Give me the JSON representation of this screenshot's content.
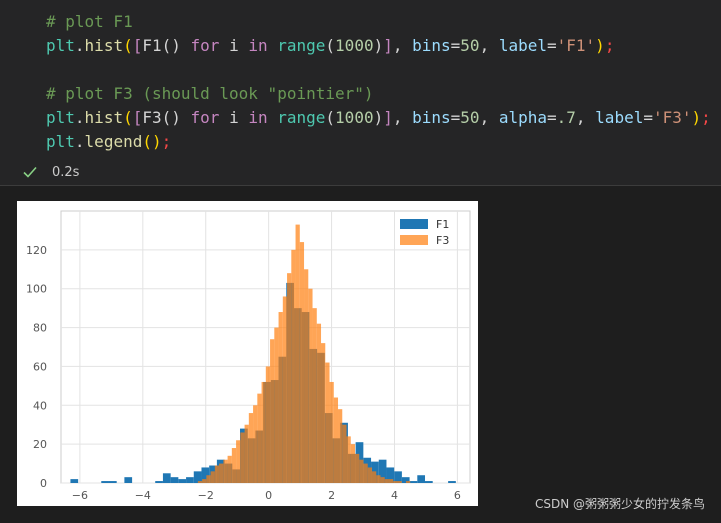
{
  "cell": {
    "code_lines": [
      [
        {
          "t": "# plot F1",
          "c": "t-comment"
        }
      ],
      [
        {
          "t": "plt",
          "c": "t-fn"
        },
        {
          "t": ".",
          "c": "t-punct"
        },
        {
          "t": "hist",
          "c": "t-builtin"
        },
        {
          "t": "(",
          "c": "t-yellow"
        },
        {
          "t": "[",
          "c": "t-kw"
        },
        {
          "t": "F1",
          "c": "t-punct"
        },
        {
          "t": "()",
          "c": "t-punct"
        },
        {
          "t": " for ",
          "c": "t-kw"
        },
        {
          "t": "i",
          "c": "t-punct"
        },
        {
          "t": " in ",
          "c": "t-kw"
        },
        {
          "t": "range",
          "c": "t-fn"
        },
        {
          "t": "(",
          "c": "t-punct"
        },
        {
          "t": "1000",
          "c": "t-num"
        },
        {
          "t": ")",
          "c": "t-punct"
        },
        {
          "t": "]",
          "c": "t-kw"
        },
        {
          "t": ", ",
          "c": "t-punct"
        },
        {
          "t": "bins",
          "c": "t-param"
        },
        {
          "t": "=",
          "c": "t-punct"
        },
        {
          "t": "50",
          "c": "t-num"
        },
        {
          "t": ", ",
          "c": "t-punct"
        },
        {
          "t": "label",
          "c": "t-param"
        },
        {
          "t": "=",
          "c": "t-punct"
        },
        {
          "t": "'F1'",
          "c": "t-str"
        },
        {
          "t": ")",
          "c": "t-yellow"
        },
        {
          "t": ";",
          "c": "t-red"
        }
      ],
      [],
      [
        {
          "t": "# plot F3 (should look \"pointier\")",
          "c": "t-comment"
        }
      ],
      [
        {
          "t": "plt",
          "c": "t-fn"
        },
        {
          "t": ".",
          "c": "t-punct"
        },
        {
          "t": "hist",
          "c": "t-builtin"
        },
        {
          "t": "(",
          "c": "t-yellow"
        },
        {
          "t": "[",
          "c": "t-kw"
        },
        {
          "t": "F3",
          "c": "t-punct"
        },
        {
          "t": "()",
          "c": "t-punct"
        },
        {
          "t": " for ",
          "c": "t-kw"
        },
        {
          "t": "i",
          "c": "t-punct"
        },
        {
          "t": " in ",
          "c": "t-kw"
        },
        {
          "t": "range",
          "c": "t-fn"
        },
        {
          "t": "(",
          "c": "t-punct"
        },
        {
          "t": "1000",
          "c": "t-num"
        },
        {
          "t": ")",
          "c": "t-punct"
        },
        {
          "t": "]",
          "c": "t-kw"
        },
        {
          "t": ", ",
          "c": "t-punct"
        },
        {
          "t": "bins",
          "c": "t-param"
        },
        {
          "t": "=",
          "c": "t-punct"
        },
        {
          "t": "50",
          "c": "t-num"
        },
        {
          "t": ", ",
          "c": "t-punct"
        },
        {
          "t": "alpha",
          "c": "t-param"
        },
        {
          "t": "=",
          "c": "t-punct"
        },
        {
          "t": ".7",
          "c": "t-num"
        },
        {
          "t": ", ",
          "c": "t-punct"
        },
        {
          "t": "label",
          "c": "t-param"
        },
        {
          "t": "=",
          "c": "t-punct"
        },
        {
          "t": "'F3'",
          "c": "t-str"
        },
        {
          "t": ")",
          "c": "t-yellow"
        },
        {
          "t": ";",
          "c": "t-red"
        }
      ],
      [
        {
          "t": "plt",
          "c": "t-fn"
        },
        {
          "t": ".",
          "c": "t-punct"
        },
        {
          "t": "legend",
          "c": "t-builtin"
        },
        {
          "t": "()",
          "c": "t-yellow"
        },
        {
          "t": ";",
          "c": "t-red"
        }
      ]
    ],
    "status_icon": "check-icon",
    "exec_time": "0.2s"
  },
  "watermark": "CSDN @粥粥粥少女的拧发条鸟",
  "colors": {
    "f1": "#1f77b4",
    "f3": "#ff7f0e"
  },
  "chart_data": {
    "type": "bar",
    "xlim": [
      -6.6,
      6.4
    ],
    "ylim": [
      0,
      140
    ],
    "xticks": [
      -6,
      -4,
      -2,
      0,
      2,
      4,
      6
    ],
    "xtick_labels": [
      "−6",
      "−4",
      "−2",
      "0",
      "2",
      "4",
      "6"
    ],
    "yticks": [
      0,
      20,
      40,
      60,
      80,
      100,
      120
    ],
    "grid": true,
    "legend_position": "top-right",
    "series": [
      {
        "name": "F1",
        "color": "#1f77b4",
        "bin_start": -6.3,
        "bin_width": 0.245,
        "values": [
          2,
          0,
          0,
          0,
          1,
          1,
          0,
          3,
          0,
          0,
          0,
          1,
          5,
          3,
          2,
          3,
          6,
          8,
          9,
          12,
          10,
          7,
          28,
          23,
          27,
          52,
          53,
          65,
          103,
          90,
          88,
          69,
          67,
          36,
          23,
          31,
          15,
          21,
          13,
          11,
          12,
          8,
          6,
          3,
          1,
          4,
          1,
          0,
          0,
          1
        ]
      },
      {
        "name": "F3",
        "color": "#ff7f0e",
        "bin_start": -2.25,
        "bin_width": 0.135,
        "values": [
          1,
          2,
          4,
          6,
          9,
          10,
          12,
          14,
          18,
          22,
          26,
          30,
          36,
          40,
          46,
          52,
          60,
          74,
          80,
          88,
          96,
          108,
          120,
          133,
          124,
          110,
          100,
          90,
          82,
          72,
          62,
          52,
          44,
          38,
          30,
          24,
          20,
          15,
          12,
          10,
          8,
          6,
          4,
          3,
          2,
          2,
          1,
          1,
          0,
          1
        ]
      }
    ]
  }
}
